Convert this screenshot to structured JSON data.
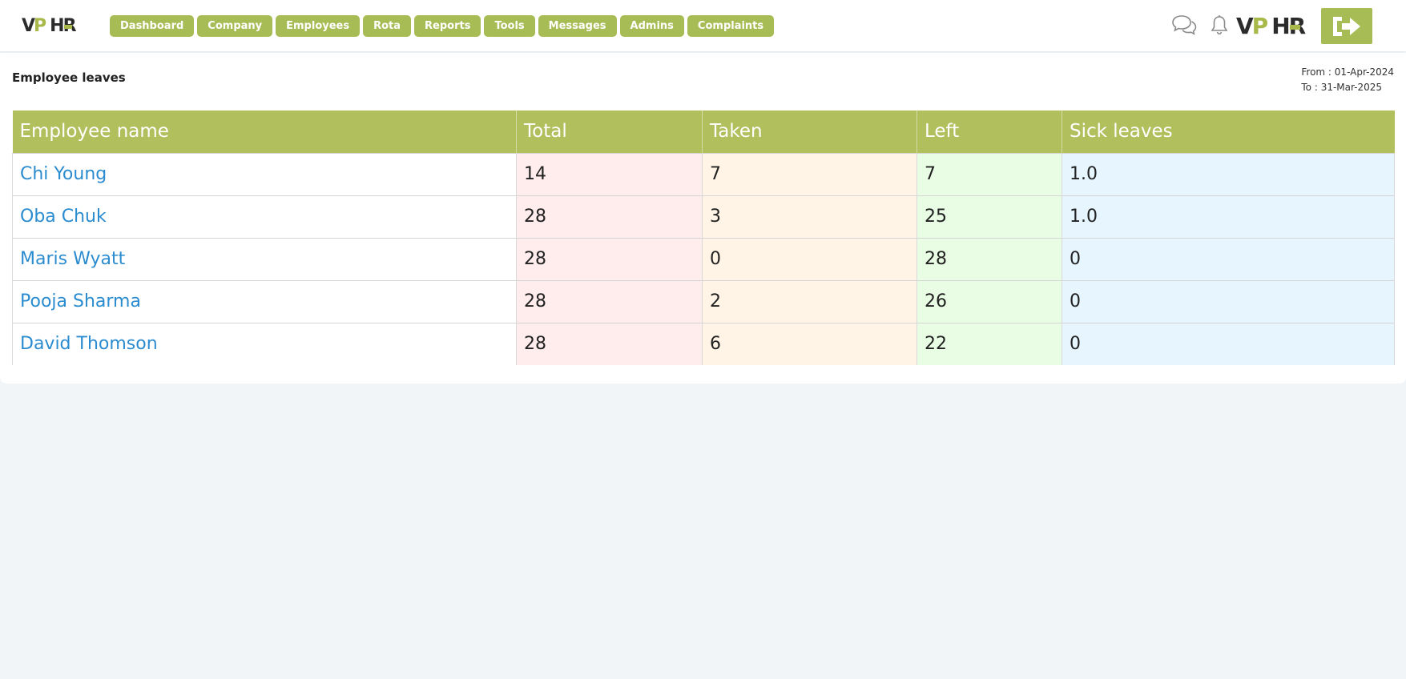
{
  "header": {
    "logo_text": "VP HR",
    "nav": [
      "Dashboard",
      "Company",
      "Employees",
      "Rota",
      "Reports",
      "Tools",
      "Messages",
      "Admins",
      "Complaints"
    ],
    "icons": [
      "chat-icon",
      "bell-icon",
      "logout-icon"
    ],
    "accent_color": "#a8bc55"
  },
  "page": {
    "title": "Employee leaves",
    "date_from": "From : 01-Apr-2024",
    "date_to": "To : 31-Mar-2025"
  },
  "table": {
    "headers": [
      "Employee name",
      "Total",
      "Taken",
      "Left",
      "Sick leaves"
    ],
    "rows": [
      {
        "name": "Chi Young",
        "total": "14",
        "taken": "7",
        "left": "7",
        "sick": "1.0"
      },
      {
        "name": "Oba Chuk",
        "total": "28",
        "taken": "3",
        "left": "25",
        "sick": "1.0"
      },
      {
        "name": "Maris Wyatt",
        "total": "28",
        "taken": "0",
        "left": "28",
        "sick": "0"
      },
      {
        "name": "Pooja Sharma",
        "total": "28",
        "taken": "2",
        "left": "26",
        "sick": "0"
      },
      {
        "name": "David Thomson",
        "total": "28",
        "taken": "6",
        "left": "22",
        "sick": "0"
      }
    ],
    "header_color": "#b1bf5d",
    "column_colors": {
      "total": "#ffecec",
      "taken": "#fff4e6",
      "left": "#e8fde4",
      "sick": "#e6f5fe"
    }
  }
}
